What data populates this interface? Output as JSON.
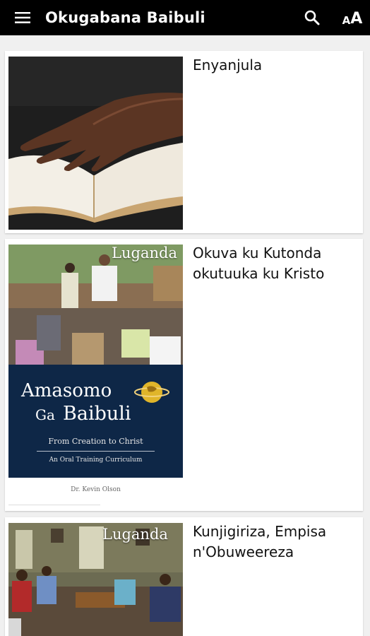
{
  "appbar": {
    "title": "Okugabana Baibuli",
    "menu_icon": "hamburger-menu-icon",
    "search_icon": "search-icon",
    "font_size_small": "A",
    "font_size_large": "A"
  },
  "books": [
    {
      "title": "Enyanjula",
      "image": "hand-on-open-bible-photo"
    },
    {
      "title": "Okuva ku Kutonda okutuuka ku Kristo",
      "image": "bible-lessons-cover",
      "cover": {
        "language": "Luganda",
        "heading_line1": "Amasomo",
        "heading_line2_a": "Ga",
        "heading_line2_b": "Baibuli",
        "subtitle": "From Creation to Christ",
        "tagline": "An Oral Training Curriculum",
        "author": "Dr. Kevin Olson"
      }
    },
    {
      "title": "Kunjigiriza, Empisa n'Obuweereza",
      "image": "group-meeting-photo",
      "cover": {
        "language": "Luganda"
      }
    }
  ],
  "colors": {
    "appbar_bg": "#000000",
    "cover_navy": "#0e2747",
    "globe_gold": "#d4a21a"
  }
}
